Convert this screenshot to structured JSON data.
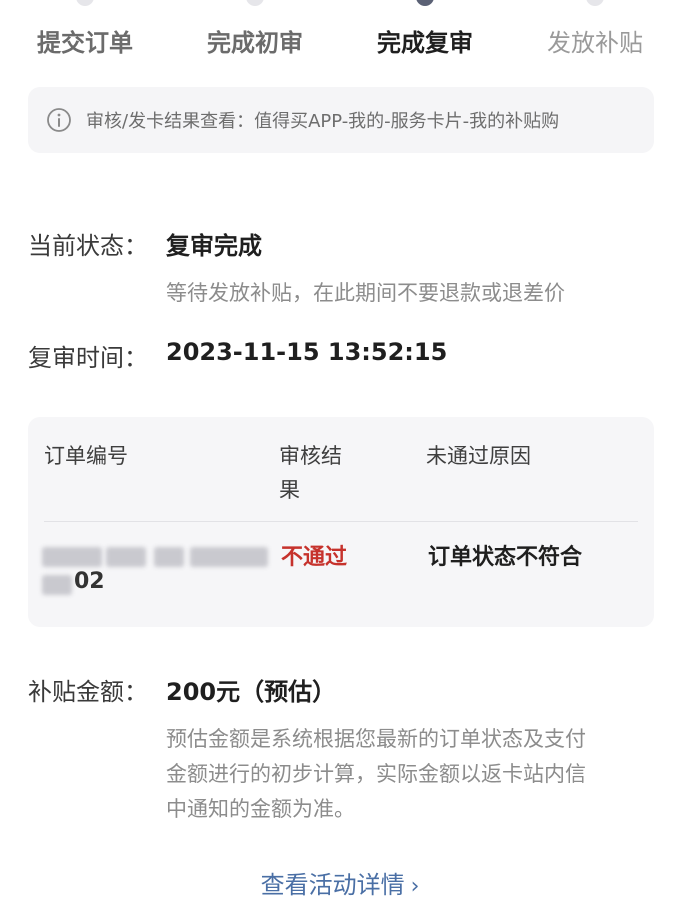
{
  "steps": [
    "提交订单",
    "完成初审",
    "完成复审",
    "发放补贴"
  ],
  "notice": {
    "icon": "info-icon",
    "text": "审核/发卡结果查看：值得买APP-我的-服务卡片-我的补贴购"
  },
  "status": {
    "label": "当前状态：",
    "value": "复审完成",
    "hint": "等待发放补贴，在此期间不要退款或退差价"
  },
  "review_time": {
    "label": "复审时间：",
    "value": "2023-11-15 13:52:15"
  },
  "table": {
    "headers": [
      "订单编号",
      "审核结\n果",
      "未通过原因"
    ],
    "row": {
      "order_tail": "02",
      "result": "不通过",
      "reason": "订单状态不符合"
    }
  },
  "subsidy": {
    "label": "补贴金额：",
    "value": "200元（预估）",
    "desc_lines": [
      "预估金额是系统根据您最新的订单状态及支付",
      "金额进行的初步计算，实际金额以返卡站内信",
      "中通知的金额为准。"
    ]
  },
  "link": {
    "label": "查看活动详情",
    "chevron": "›"
  },
  "colors": {
    "accent_link": "#4a6fa5",
    "fail_red": "#c6322c",
    "active_dot": "#5b6175"
  }
}
